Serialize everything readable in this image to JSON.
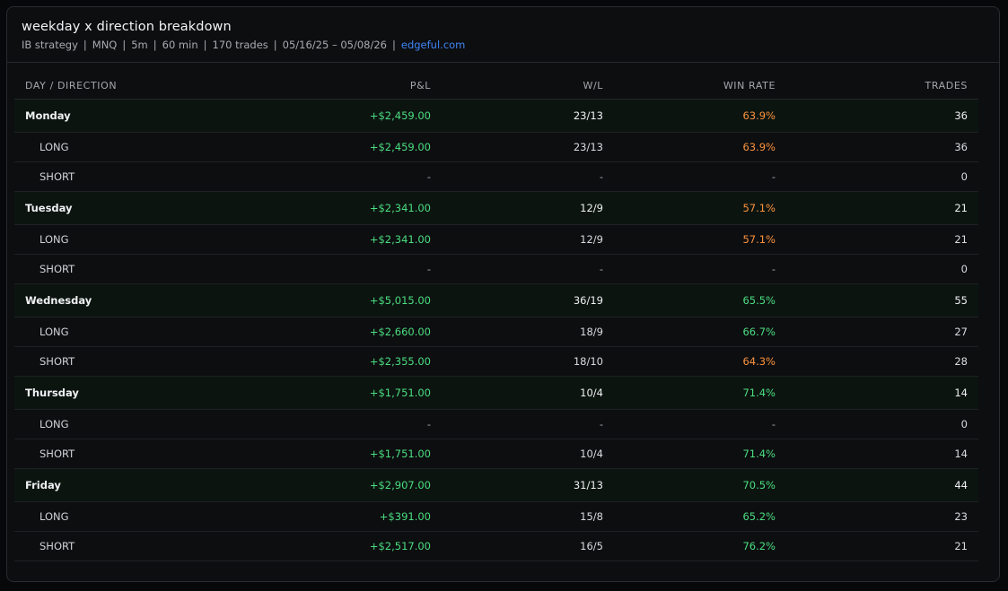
{
  "header": {
    "title": "weekday x direction breakdown",
    "subtitle_parts": [
      "IB strategy",
      "MNQ",
      "5m",
      "60 min",
      "170 trades",
      "05/16/25 – 05/08/26"
    ],
    "separator": "|",
    "link": "edgeful.com"
  },
  "table": {
    "columns": [
      "DAY / DIRECTION",
      "P&L",
      "W/L",
      "WIN RATE",
      "TRADES"
    ],
    "rows": [
      {
        "kind": "day",
        "label": "Monday",
        "pnl": "+$2,459.00",
        "wl": "23/13",
        "win_rate": "63.9%",
        "rate_color": "orange",
        "trades": "36"
      },
      {
        "kind": "dir",
        "label": "LONG",
        "pnl": "+$2,459.00",
        "wl": "23/13",
        "win_rate": "63.9%",
        "rate_color": "orange",
        "trades": "36"
      },
      {
        "kind": "dir",
        "label": "SHORT",
        "pnl": "-",
        "wl": "-",
        "win_rate": "-",
        "rate_color": "dash",
        "trades": "0"
      },
      {
        "kind": "day",
        "label": "Tuesday",
        "pnl": "+$2,341.00",
        "wl": "12/9",
        "win_rate": "57.1%",
        "rate_color": "orange",
        "trades": "21"
      },
      {
        "kind": "dir",
        "label": "LONG",
        "pnl": "+$2,341.00",
        "wl": "12/9",
        "win_rate": "57.1%",
        "rate_color": "orange",
        "trades": "21"
      },
      {
        "kind": "dir",
        "label": "SHORT",
        "pnl": "-",
        "wl": "-",
        "win_rate": "-",
        "rate_color": "dash",
        "trades": "0"
      },
      {
        "kind": "day",
        "label": "Wednesday",
        "pnl": "+$5,015.00",
        "wl": "36/19",
        "win_rate": "65.5%",
        "rate_color": "green",
        "trades": "55"
      },
      {
        "kind": "dir",
        "label": "LONG",
        "pnl": "+$2,660.00",
        "wl": "18/9",
        "win_rate": "66.7%",
        "rate_color": "green",
        "trades": "27"
      },
      {
        "kind": "dir",
        "label": "SHORT",
        "pnl": "+$2,355.00",
        "wl": "18/10",
        "win_rate": "64.3%",
        "rate_color": "orange",
        "trades": "28"
      },
      {
        "kind": "day",
        "label": "Thursday",
        "pnl": "+$1,751.00",
        "wl": "10/4",
        "win_rate": "71.4%",
        "rate_color": "green",
        "trades": "14"
      },
      {
        "kind": "dir",
        "label": "LONG",
        "pnl": "-",
        "wl": "-",
        "win_rate": "-",
        "rate_color": "dash",
        "trades": "0"
      },
      {
        "kind": "dir",
        "label": "SHORT",
        "pnl": "+$1,751.00",
        "wl": "10/4",
        "win_rate": "71.4%",
        "rate_color": "green",
        "trades": "14"
      },
      {
        "kind": "day",
        "label": "Friday",
        "pnl": "+$2,907.00",
        "wl": "31/13",
        "win_rate": "70.5%",
        "rate_color": "green",
        "trades": "44"
      },
      {
        "kind": "dir",
        "label": "LONG",
        "pnl": "+$391.00",
        "wl": "15/8",
        "win_rate": "65.2%",
        "rate_color": "green",
        "trades": "23"
      },
      {
        "kind": "dir",
        "label": "SHORT",
        "pnl": "+$2,517.00",
        "wl": "16/5",
        "win_rate": "76.2%",
        "rate_color": "green",
        "trades": "21"
      }
    ]
  },
  "colors": {
    "positive": "#4ade80",
    "orange": "#fb923c",
    "link": "#3f86f5"
  }
}
